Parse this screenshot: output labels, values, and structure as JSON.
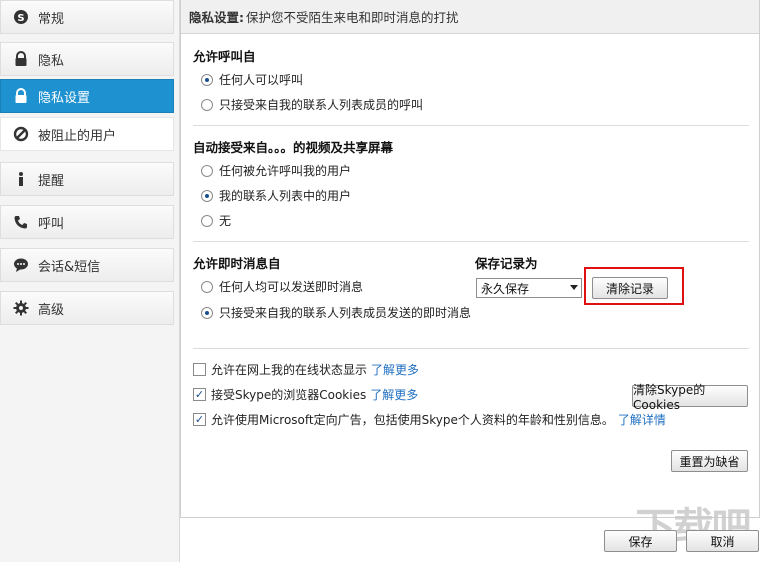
{
  "sidebar": {
    "items": [
      {
        "label": "常规",
        "icon": "skype-icon"
      },
      {
        "label": "隐私",
        "icon": "lock-icon"
      },
      {
        "label": "隐私设置",
        "icon": "lock-icon",
        "selected": true
      },
      {
        "label": "被阻止的用户",
        "icon": "block-icon"
      },
      {
        "label": "提醒",
        "icon": "info-icon"
      },
      {
        "label": "呼叫",
        "icon": "phone-icon"
      },
      {
        "label": "会话&短信",
        "icon": "chat-icon"
      },
      {
        "label": "高级",
        "icon": "gear-icon"
      }
    ]
  },
  "header": {
    "title": "隐私设置:",
    "subtitle": "保护您不受陌生来电和即时消息的打扰"
  },
  "calls": {
    "title": "允许呼叫自",
    "options": [
      {
        "label": "任何人可以呼叫",
        "checked": true
      },
      {
        "label": "只接受来自我的联系人列表成员的呼叫",
        "checked": false
      }
    ]
  },
  "video": {
    "title": "自动接受来自。。。的视频及共享屏幕",
    "options": [
      {
        "label": "任何被允许呼叫我的用户",
        "checked": false
      },
      {
        "label": "我的联系人列表中的用户",
        "checked": true
      },
      {
        "label": "无",
        "checked": false
      }
    ]
  },
  "im": {
    "title": "允许即时消息自",
    "options": [
      {
        "label": "任何人均可以发送即时消息",
        "checked": false
      },
      {
        "label": "只接受来自我的联系人列表成员发送的即时消息",
        "checked": true
      }
    ]
  },
  "history": {
    "title": "保存记录为",
    "selected": "永久保存",
    "clear_button": "清除记录"
  },
  "checks": [
    {
      "label": "允许在网上我的在线状态显示",
      "link": "了解更多",
      "checked": false
    },
    {
      "label": "接受Skype的浏览器Cookies",
      "link": "了解更多",
      "checked": true
    },
    {
      "label": "允许使用Microsoft定向广告，包括使用Skype个人资料的年龄和性别信息。",
      "link": "了解详情",
      "checked": true
    }
  ],
  "buttons": {
    "clear_cookies": "清除Skype的Cookies",
    "reset": "重置为缺省",
    "save": "保存",
    "cancel": "取消"
  },
  "watermark": "下载吧",
  "colors": {
    "accent": "#1e91d0",
    "highlight": "#e01010",
    "link": "#1f6fc2"
  }
}
